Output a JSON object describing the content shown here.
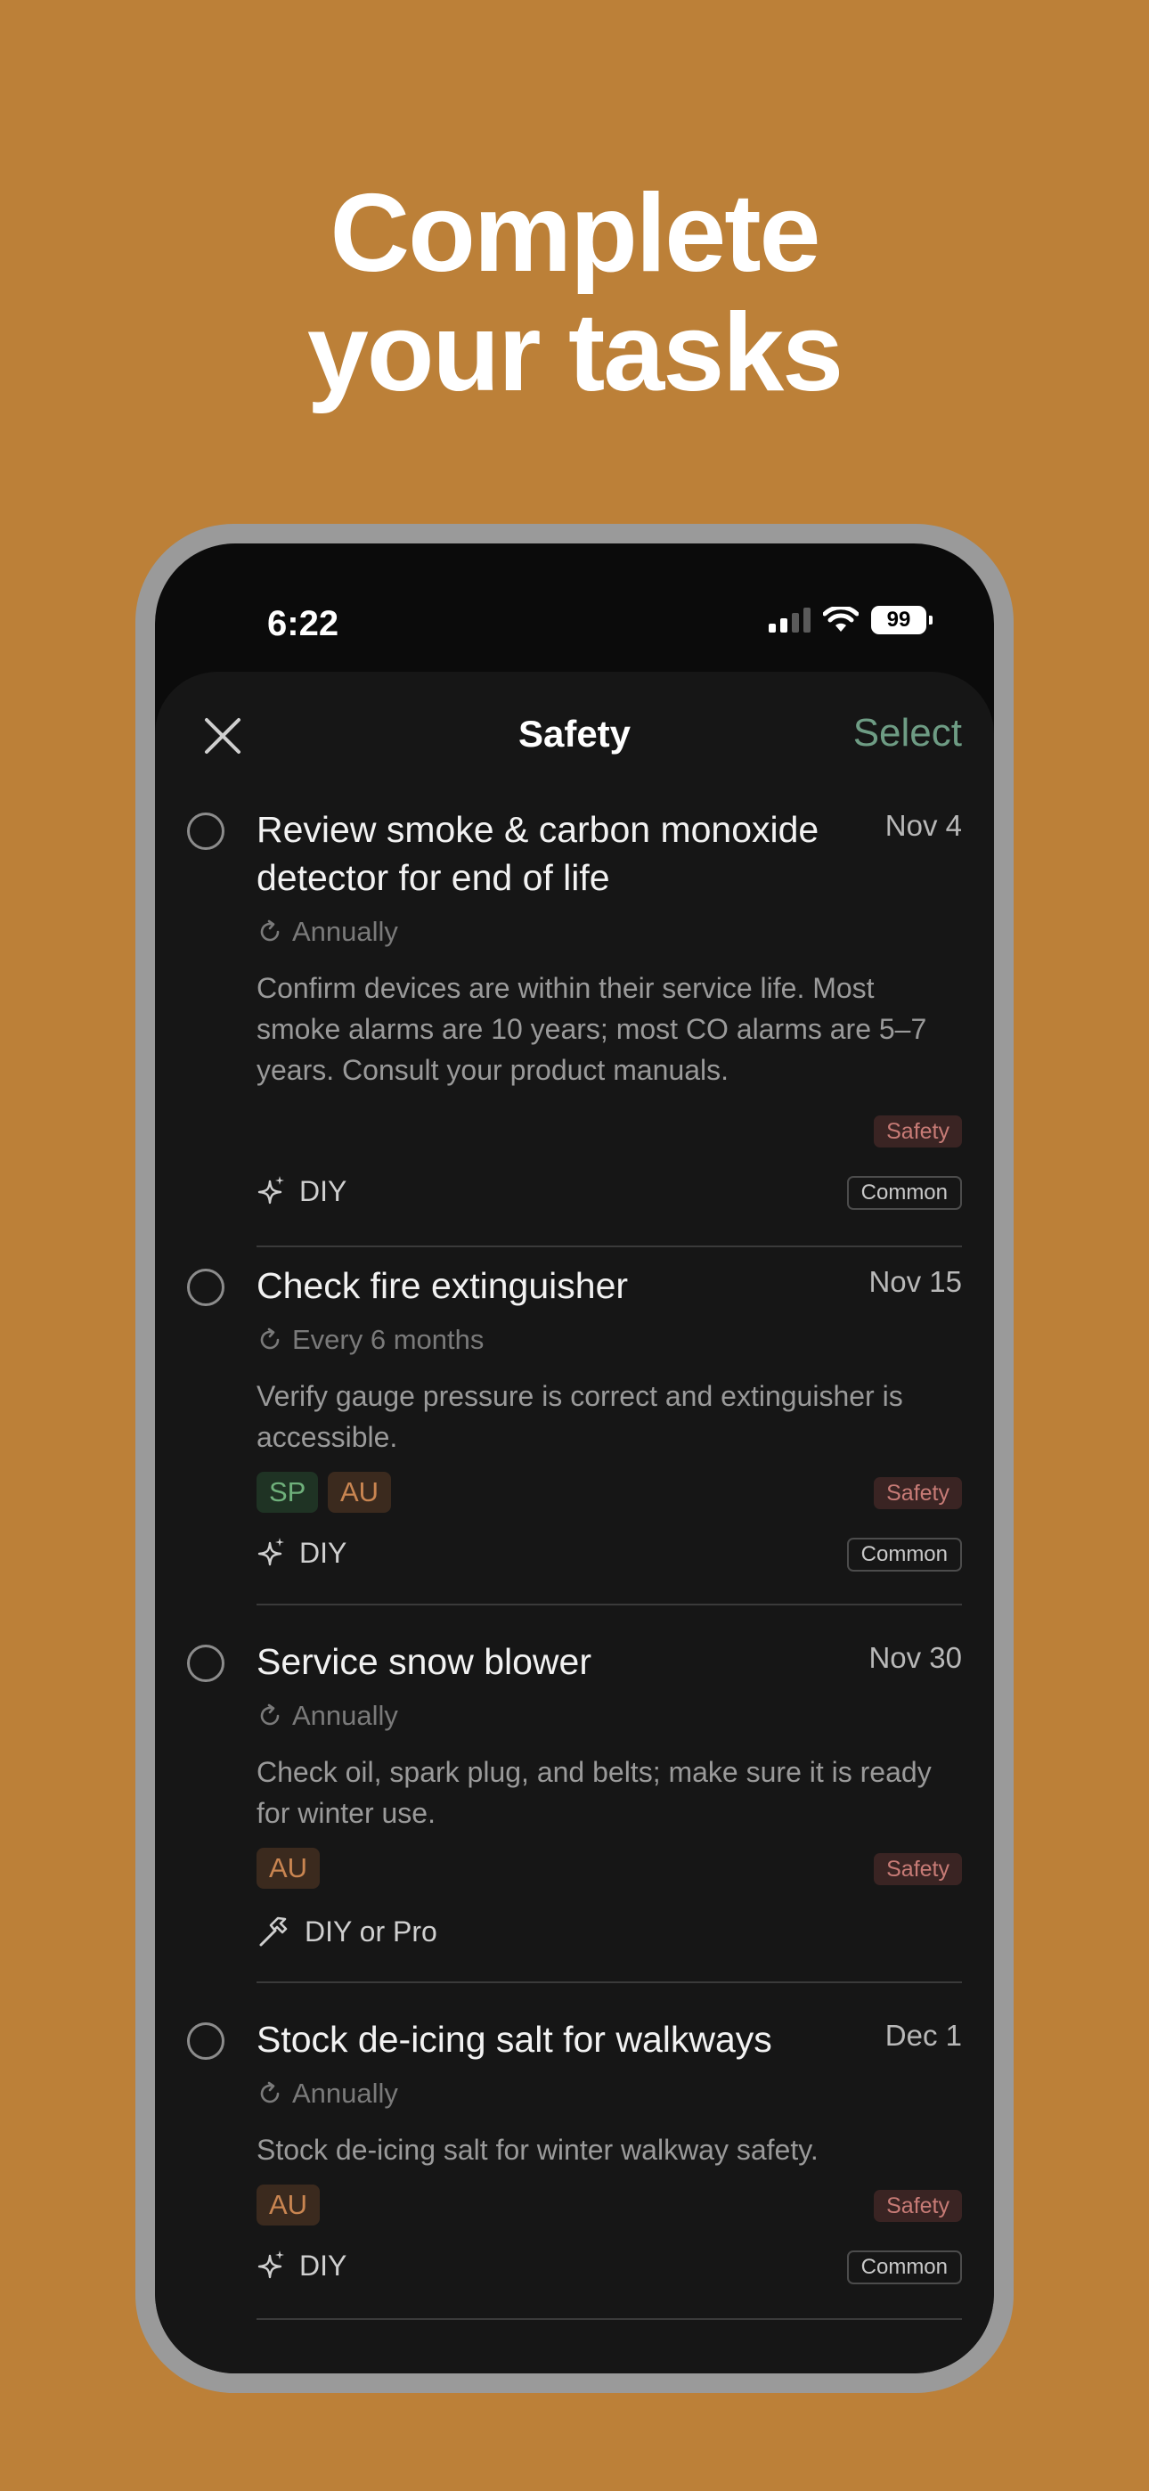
{
  "headline": {
    "line1": "Complete",
    "line2": "your tasks"
  },
  "status_bar": {
    "time": "6:22",
    "battery": "99"
  },
  "nav": {
    "title": "Safety",
    "select_label": "Select"
  },
  "tasks": [
    {
      "title": "Review smoke & carbon monoxide detector for end of life",
      "date": "Nov 4",
      "recurrence": "Annually",
      "description": "Confirm devices are within their service life. Most smoke alarms are 10 years; most CO alarms are 5–7 years. Consult your product manuals.",
      "region_tags": [],
      "category": "Safety",
      "method": "DIY",
      "method_icon": "sparkle-icon",
      "frequency_tag": "Common"
    },
    {
      "title": "Check fire extinguisher",
      "date": "Nov 15",
      "recurrence": "Every 6 months",
      "description": "Verify gauge pressure is correct and extinguisher is accessible.",
      "region_tags": [
        "SP",
        "AU"
      ],
      "category": "Safety",
      "method": "DIY",
      "method_icon": "sparkle-icon",
      "frequency_tag": "Common"
    },
    {
      "title": "Service snow blower",
      "date": "Nov 30",
      "recurrence": "Annually",
      "description": "Check oil, spark plug, and belts; make sure it is ready for winter use.",
      "region_tags": [
        "AU"
      ],
      "category": "Safety",
      "method": "DIY or Pro",
      "method_icon": "hammer-icon",
      "frequency_tag": ""
    },
    {
      "title": "Stock de-icing salt for walkways",
      "date": "Dec 1",
      "recurrence": "Annually",
      "description": "Stock de-icing salt for winter walkway safety.",
      "region_tags": [
        "AU"
      ],
      "category": "Safety",
      "method": "DIY",
      "method_icon": "sparkle-icon",
      "frequency_tag": "Common"
    }
  ],
  "colors": {
    "background": "#BC8038",
    "accent_select": "#6E9C84",
    "safety_tag": "#C77B76",
    "sp_tag": "#6FB07B",
    "au_tag": "#C98551"
  }
}
